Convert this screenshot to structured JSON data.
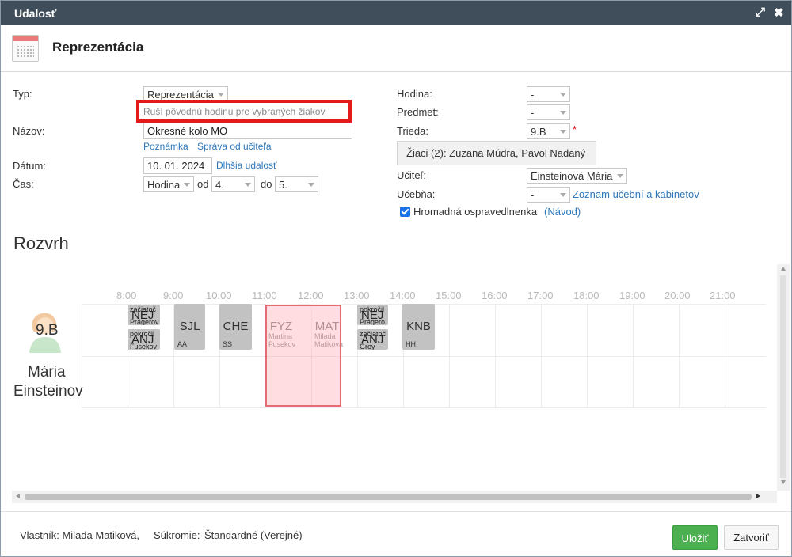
{
  "window": {
    "title": "Udalosť"
  },
  "header": {
    "title": "Reprezentácia"
  },
  "form": {
    "type_label": "Typ:",
    "type_value": "Reprezentácia",
    "cancel_link": "Ruší pôvodnú hodinu pre vybraných žiakov",
    "name_label": "Názov:",
    "name_value": "Okresné kolo MO",
    "note_link": "Poznámka",
    "teacher_msg_link": "Správa od učiteľa",
    "date_label": "Dátum:",
    "date_value": "10. 01. 2024",
    "longer_link": "Dlhšia udalosť",
    "time_label": "Čas:",
    "time_mode": "Hodina",
    "from_label": "od",
    "from_value": "4.",
    "to_label": "do",
    "to_value": "5.",
    "hour_label": "Hodina:",
    "hour_value": "-",
    "subject_label": "Predmet:",
    "subject_value": "-",
    "class_label": "Trieda:",
    "class_value": "9.B",
    "required_mark": "*",
    "pupils_button": "Žiaci (2): Zuzana Múdra, Pavol Nadaný",
    "teacher_label": "Učiteľ:",
    "teacher_value": "Einsteinová Mária",
    "room_label": "Učebňa:",
    "room_value": "-",
    "rooms_link": "Zoznam učební a kabinetov",
    "excuse_label": "Hromadná ospravedlnenka",
    "excuse_checked": true,
    "guide_link": "(Návod)"
  },
  "schedule": {
    "title": "Rozvrh",
    "hours": [
      "8:00",
      "9:00",
      "10:00",
      "11:00",
      "12:00",
      "13:00",
      "14:00",
      "15:00",
      "16:00",
      "17:00",
      "18:00",
      "19:00",
      "20:00",
      "21:00"
    ],
    "rows": [
      {
        "label": "9.B"
      },
      {
        "label_line1": "Mária",
        "label_line2": "Einsteinov"
      }
    ],
    "lessons": [
      {
        "subject": "SJL",
        "teacher": "AA"
      },
      {
        "subject": "CHE",
        "teacher": "SS"
      },
      {
        "subject": "FYZ",
        "teacher": "Martina Fusekov"
      },
      {
        "subject": "MAT",
        "teacher": "Milada Matikova"
      },
      {
        "subject": "KNB",
        "teacher": "HH"
      }
    ],
    "split": [
      {
        "group": "začiatoč",
        "subject": "NEJ",
        "teacher": "Prágerov"
      },
      {
        "group": "pokročil",
        "subject": "ANJ",
        "teacher": "Fusekov"
      },
      {
        "group": "pokročil",
        "subject": "NEJ",
        "teacher": "Prágero"
      },
      {
        "group": "začiatoč",
        "subject": "ANJ",
        "teacher": "Grey"
      }
    ]
  },
  "footer": {
    "owner_label": "Vlastník: Milada Matiková,",
    "privacy_label": "Súkromie:",
    "privacy_value": "Štandardné (Verejné)",
    "save_button": "Uložiť",
    "close_button": "Zatvoriť"
  },
  "colors": {
    "titlebar": "#3f4e5a",
    "link": "#2e77b9",
    "save": "#4caf50",
    "highlight": "#e41b1b"
  }
}
